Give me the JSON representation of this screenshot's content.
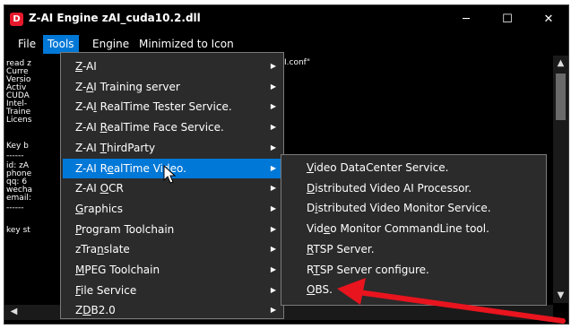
{
  "window": {
    "title": "Z-AI Engine zAI_cuda10.2.dll",
    "icon_letter": "D",
    "minimize_glyph": "─",
    "maximize_glyph": "☐",
    "close_glyph": "✕"
  },
  "menubar": {
    "items": [
      "File",
      "Tools",
      "Engine",
      "Minimized to Icon"
    ]
  },
  "console": {
    "lines": [
      "read z",
      "Curre",
      "Versio",
      "Activ",
      "CUDA",
      "Intel-",
      "Traine",
      "Licens",
      "",
      "",
      "Key b",
      "------",
      "id: zA",
      "phone",
      "qq: 6",
      "wecha",
      "email:",
      "------",
      "",
      "key st"
    ],
    "line1_suffix": "I.conf\""
  },
  "tools_menu": {
    "items": [
      {
        "pre": "",
        "ul": "Z",
        "post": "-AI",
        "has_sub": true,
        "highlighted": false
      },
      {
        "pre": "Z-",
        "ul": "A",
        "post": "I Training server",
        "has_sub": true,
        "highlighted": false
      },
      {
        "pre": "Z-A",
        "ul": "I",
        "post": " RealTime Tester Service.",
        "has_sub": true,
        "highlighted": false
      },
      {
        "pre": "Z-AI ",
        "ul": "R",
        "post": "ealTime Face Service.",
        "has_sub": true,
        "highlighted": false
      },
      {
        "pre": "Z-AI ",
        "ul": "T",
        "post": "hirdParty",
        "has_sub": true,
        "highlighted": false
      },
      {
        "pre": "Z-AI R",
        "ul": "e",
        "post": "alTime Video.",
        "has_sub": true,
        "highlighted": true
      },
      {
        "pre": "Z-AI ",
        "ul": "O",
        "post": "CR",
        "has_sub": true,
        "highlighted": false
      },
      {
        "pre": "",
        "ul": "G",
        "post": "raphics",
        "has_sub": true,
        "highlighted": false
      },
      {
        "pre": "",
        "ul": "P",
        "post": "rogram Toolchain",
        "has_sub": true,
        "highlighted": false
      },
      {
        "pre": "zTra",
        "ul": "n",
        "post": "slate",
        "has_sub": true,
        "highlighted": false
      },
      {
        "pre": "",
        "ul": "M",
        "post": "PEG Toolchain",
        "has_sub": true,
        "highlighted": false
      },
      {
        "pre": "",
        "ul": "F",
        "post": "ile Service",
        "has_sub": true,
        "highlighted": false
      },
      {
        "pre": "Z",
        "ul": "D",
        "post": "B2.0",
        "has_sub": true,
        "highlighted": false
      }
    ]
  },
  "video_submenu": {
    "items": [
      {
        "pre": "",
        "ul": "V",
        "post": "ideo DataCenter Service."
      },
      {
        "pre": "",
        "ul": "D",
        "post": "istributed Video AI Processor."
      },
      {
        "pre": "D",
        "ul": "i",
        "post": "stributed Video Monitor Service."
      },
      {
        "pre": "Vid",
        "ul": "e",
        "post": "o Monitor CommandLine tool."
      },
      {
        "pre": "",
        "ul": "R",
        "post": "TSP Server."
      },
      {
        "pre": "R",
        "ul": "T",
        "post": "SP Server configure."
      },
      {
        "pre": "",
        "ul": "O",
        "post": "BS."
      }
    ]
  },
  "annotation": {
    "arrow_color": "#e8141e"
  },
  "colors": {
    "highlight": "#0078d7",
    "menu_bg": "#2b2b2b",
    "window_bg": "#000000"
  }
}
